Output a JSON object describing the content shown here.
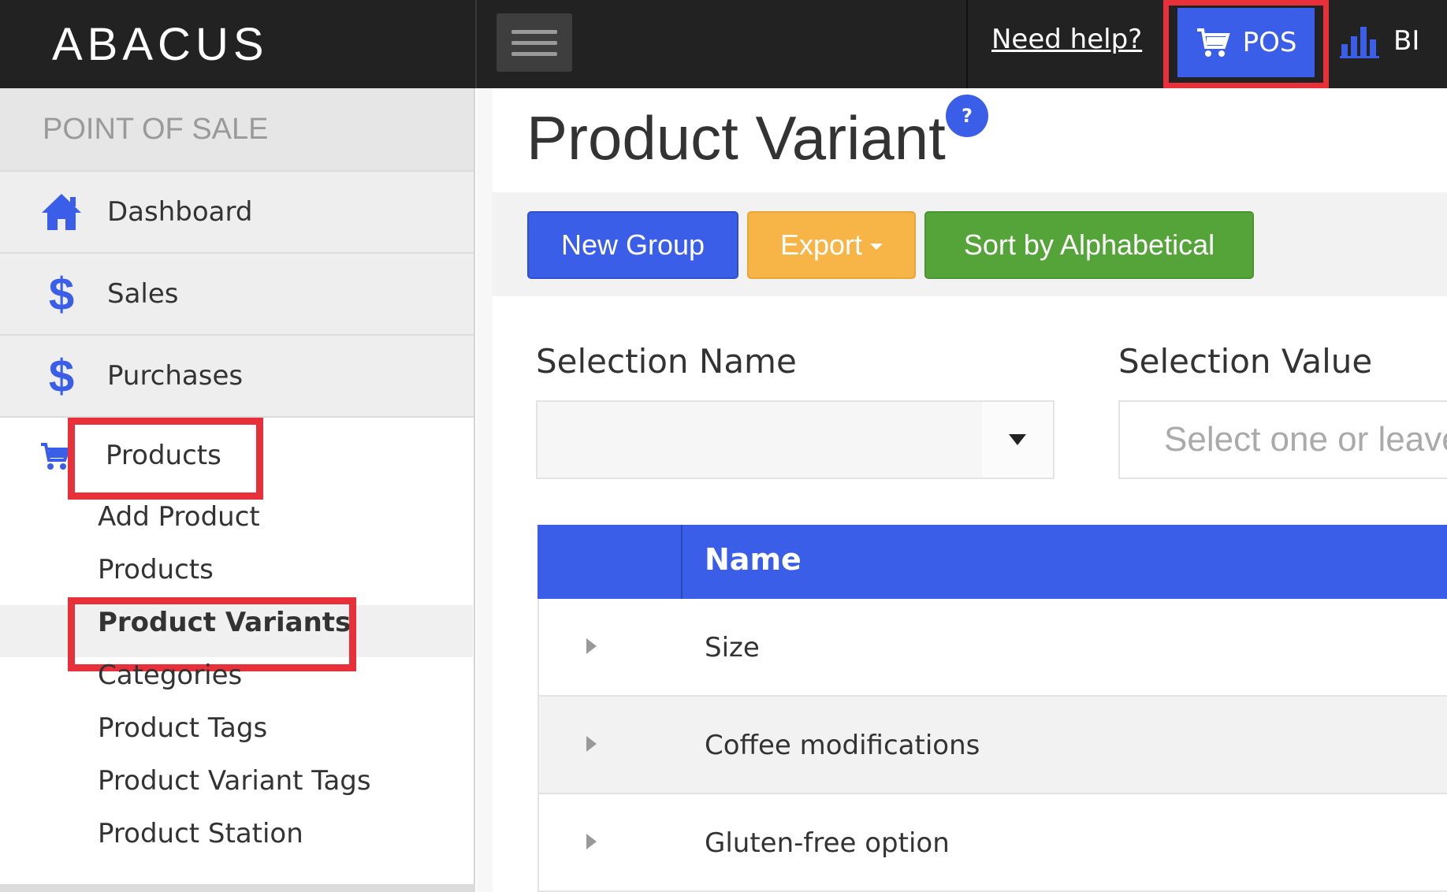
{
  "header": {
    "brand": "ABACUS",
    "help_link": "Need help?",
    "pos_label": "POS",
    "bi_label": "BI"
  },
  "sidebar": {
    "section_title": "POINT OF SALE",
    "items": [
      {
        "label": "Dashboard",
        "icon": "home-icon"
      },
      {
        "label": "Sales",
        "icon": "dollar-icon"
      },
      {
        "label": "Purchases",
        "icon": "dollar-icon"
      },
      {
        "label": "Products",
        "icon": "cart-icon"
      }
    ],
    "sub_items": [
      "Add Product",
      "Products",
      "Product Variants",
      "Categories",
      "Product Tags",
      "Product Variant Tags",
      "Product Station"
    ],
    "active_sub_item": "Product Variants"
  },
  "main": {
    "title": "Product Variant",
    "help_badge": "?",
    "buttons": {
      "new_group": "New Group",
      "export": "Export",
      "sort": "Sort by Alphabetical"
    },
    "filters": {
      "selection_name_label": "Selection Name",
      "selection_name_value": "",
      "selection_value_label": "Selection Value",
      "selection_value_placeholder": "Select one or leave blank"
    },
    "table": {
      "header_name": "Name",
      "rows": [
        "Size",
        "Coffee modifications",
        "Gluten-free option"
      ]
    }
  },
  "colors": {
    "topbar": "#222222",
    "primary": "#3a5ee8",
    "warning": "#f7b548",
    "success": "#55a43a",
    "highlight": "#e8303a"
  }
}
